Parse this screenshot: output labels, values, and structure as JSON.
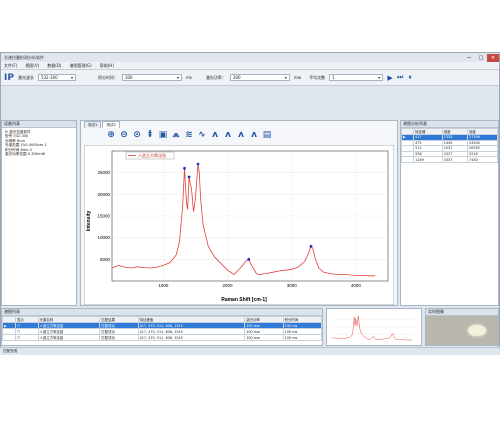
{
  "window": {
    "title": "光谱拉曼检测分析软件",
    "controls": [
      "—",
      "□",
      "✕"
    ]
  },
  "menu": [
    "文件(F)",
    "视图(V)",
    "数据(D)",
    "谱图管理(G)",
    "帮助(H)"
  ],
  "toolbar": {
    "logo": "IP",
    "laser_label": "激光波长",
    "laser_value": "532-300",
    "exposure_label": "积分时间：",
    "exposure_value": "300",
    "exposure_unit": "ms",
    "laser_power_label": "激光功率：",
    "laser_power_value": "300",
    "laser_power_unit": "mw",
    "avg_label": "平均次数",
    "avg_value": "1"
  },
  "device_panel": {
    "header": "设备列表",
    "items": [
      "⊟ 激光拉曼软件",
      "    型号  532-300",
      "    分辨率  8nm",
      "    光谱范围  150-4000cm-1",
      "    积分时间  8ms-3",
      "    激光功率范围  0-300mW"
    ]
  },
  "tabs": [
    "测试1",
    "测试2"
  ],
  "chart_data": {
    "type": "line",
    "legend": "人造立方氧化锆",
    "xlabel": "Raman Shift [cm-1]",
    "ylabel": "Intensity",
    "xlim": [
      200,
      4500
    ],
    "ylim": [
      0,
      30000
    ],
    "xticks": [
      1000,
      2000,
      3000,
      4000
    ],
    "yticks": [
      5000,
      10000,
      15000,
      20000,
      25000
    ],
    "grid": true,
    "series": [
      {
        "name": "人造立方氧化锆",
        "x": [
          200,
          300,
          400,
          500,
          600,
          700,
          800,
          900,
          1000,
          1100,
          1200,
          1250,
          1300,
          1330,
          1360,
          1380,
          1400,
          1440,
          1470,
          1500,
          1540,
          1560,
          1580,
          1620,
          1700,
          1800,
          1900,
          2000,
          2100,
          2200,
          2280,
          2330,
          2380,
          2450,
          2500,
          2600,
          2700,
          2800,
          2900,
          3000,
          3100,
          3200,
          3250,
          3300,
          3330,
          3360,
          3420,
          3500,
          3600,
          3700,
          3800,
          3900,
          4000,
          4100,
          4200,
          4300
        ],
        "y": [
          3000,
          3600,
          3200,
          3000,
          3300,
          3100,
          3000,
          3200,
          3600,
          4200,
          6000,
          9000,
          17000,
          26000,
          18000,
          16500,
          24000,
          21000,
          16000,
          19000,
          27000,
          25000,
          19000,
          13000,
          8000,
          5500,
          4000,
          2500,
          1500,
          3000,
          4500,
          5000,
          3500,
          1700,
          1500,
          1700,
          2000,
          2300,
          2500,
          2700,
          3200,
          4500,
          6000,
          8000,
          7500,
          5500,
          3000,
          2000,
          1700,
          1500,
          1500,
          1400,
          1300,
          1300,
          1200,
          1200
        ]
      }
    ],
    "peaks": [
      {
        "x": 1330,
        "y": 26000
      },
      {
        "x": 1400,
        "y": 24000
      },
      {
        "x": 1540,
        "y": 27000
      },
      {
        "x": 2330,
        "y": 5000
      },
      {
        "x": 3300,
        "y": 8000
      }
    ]
  },
  "peak_panel": {
    "header": "谱图分析列表",
    "columns": [
      "",
      "特征峰",
      "强度",
      "信度"
    ],
    "rows": [
      [
        "▶",
        "417",
        "1335",
        "27306"
      ],
      [
        "",
        "475",
        "1445",
        "24300"
      ],
      [
        "",
        "511",
        "1537",
        "26765"
      ],
      [
        "",
        "558",
        "2327",
        "5216"
      ],
      [
        "",
        "1249",
        "3337",
        "7430"
      ]
    ]
  },
  "spectrum_panel": {
    "header": "谱图列表",
    "columns": [
      "",
      "显示",
      "光谱名称",
      "匹配结果",
      "特征峰值",
      "激光功率",
      "积分时间"
    ],
    "rows": [
      [
        "▶",
        "☐",
        "人造立方氧化锆",
        "匹配成功",
        "417, 470, 511, 608, 1245",
        "100 mw",
        "100 ms"
      ],
      [
        "",
        "☐",
        "人造立方氧化锆",
        "匹配成功",
        "417, 470, 511, 608, 1245",
        "100 mw",
        "100 ms"
      ],
      [
        "",
        "☐",
        "人造立方氧化锆",
        "匹配成功",
        "417, 470, 511, 608, 1245",
        "100 mw",
        "100 ms"
      ]
    ]
  },
  "camera_panel": {
    "header": "实时图像"
  },
  "status": "匹配完成"
}
